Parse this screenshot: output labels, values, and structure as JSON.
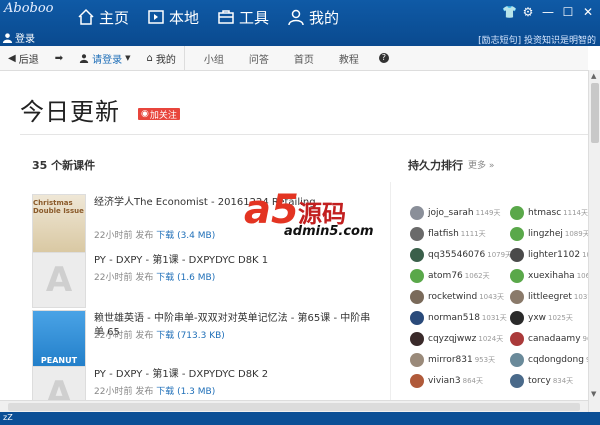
{
  "app": {
    "logo": "Aboboo",
    "user_label": "登录",
    "notice": "[励志短句] 投资知识是明智的",
    "nav": [
      {
        "label": "主页",
        "icon": "home-icon"
      },
      {
        "label": "本地",
        "icon": "folder-icon"
      },
      {
        "label": "工具",
        "icon": "toolbox-icon"
      },
      {
        "label": "我的",
        "icon": "person-icon"
      }
    ]
  },
  "toolbar": {
    "back": "后退",
    "login": "请登录",
    "mine": "我的",
    "links": [
      "小组",
      "问答",
      "首页",
      "教程"
    ]
  },
  "page": {
    "title": "今日更新",
    "follow": "加关注",
    "courses_heading": "35 个新课件",
    "ranking_heading": "持久力排行",
    "more": "更多 »"
  },
  "courses": [
    {
      "title": "经济学人The Economist - 20161224 Retailing",
      "meta": "22小时前 发布",
      "download": "下载 (3.4 MB)",
      "cover": "Christmas Double Issue"
    },
    {
      "title": "PY - DXPY - 第1课 - DXPYDYC D8K 1",
      "meta": "22小时前 发布",
      "download": "下载 (1.6 MB)",
      "cover": "A"
    },
    {
      "title": "赖世雄英语 - 中阶串单-双双对对英单记忆法 - 第65课 - 中阶串单 65",
      "meta": "22小时前 发布",
      "download": "下载 (713.3 KB)",
      "cover": "PEANUT"
    },
    {
      "title": "PY - DXPY - 第1课 - DXPYDYC D8K 2",
      "meta": "22小时前 发布",
      "download": "下载 (1.3 MB)",
      "cover": "A"
    }
  ],
  "ranking_left": [
    {
      "name": "jojo_sarah",
      "days": "1149天",
      "color": "#8a8f99"
    },
    {
      "name": "flatfish",
      "days": "1111天",
      "color": "#6a6a6a"
    },
    {
      "name": "qq35546076",
      "days": "1079天",
      "color": "#3a5f4a"
    },
    {
      "name": "atom76",
      "days": "1062天",
      "color": "#5aa84a"
    },
    {
      "name": "rocketwind",
      "days": "1043天",
      "color": "#7a6a5a"
    },
    {
      "name": "norman518",
      "days": "1031天",
      "color": "#2a4a7a"
    },
    {
      "name": "cqyzqjwwz",
      "days": "1024天",
      "color": "#3a2a2a"
    },
    {
      "name": "mirror831",
      "days": "953天",
      "color": "#9a8a7a"
    },
    {
      "name": "vivian3",
      "days": "864天",
      "color": "#b05a3a"
    }
  ],
  "ranking_right": [
    {
      "name": "htmasc",
      "days": "1114天",
      "color": "#5aa84a"
    },
    {
      "name": "lingzhej",
      "days": "1089天",
      "color": "#5aa84a"
    },
    {
      "name": "lighter1102",
      "days": "1064天",
      "color": "#4a4a4a"
    },
    {
      "name": "xuexihaha",
      "days": "1061天",
      "color": "#5aa84a"
    },
    {
      "name": "littleegret",
      "days": "1037天",
      "color": "#8a7a6a"
    },
    {
      "name": "yxw",
      "days": "1025天",
      "color": "#2a2a2a"
    },
    {
      "name": "canadaamy",
      "days": "969天",
      "color": "#aa3a3a"
    },
    {
      "name": "cqdongdong",
      "days": "929天",
      "color": "#6a8a9a"
    },
    {
      "name": "torcy",
      "days": "834天",
      "color": "#4a6a8a"
    }
  ],
  "watermark": {
    "brand": "a5",
    "name": "源码",
    "domain": "admin5.com"
  },
  "status": "zZ"
}
